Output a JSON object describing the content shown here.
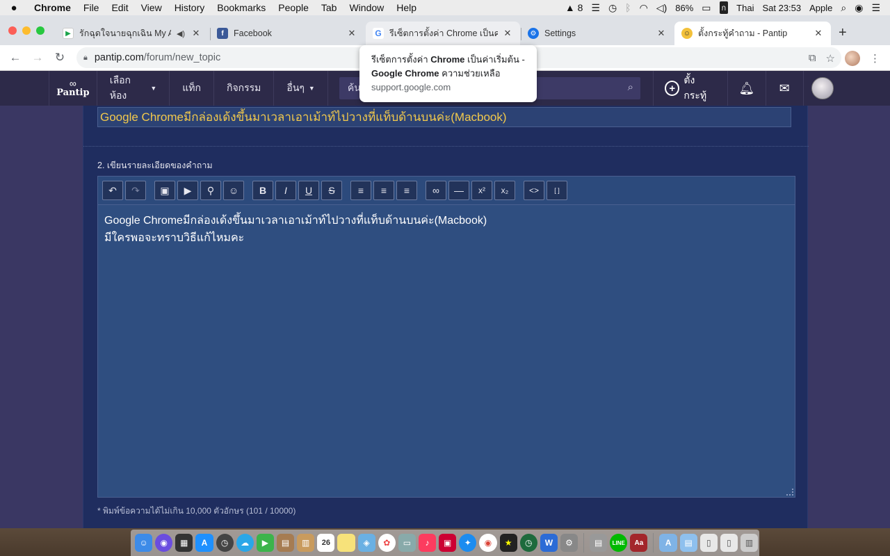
{
  "menubar": {
    "apple": "",
    "items": [
      "Chrome",
      "File",
      "Edit",
      "View",
      "History",
      "Bookmarks",
      "People",
      "Tab",
      "Window",
      "Help"
    ],
    "adobe_count": "8",
    "battery": "86%",
    "input_source": "Thai",
    "clock": "Sat 23:53",
    "user": "Apple"
  },
  "tabs": [
    {
      "title": "รักฉุดใจนายฉุกเฉิน My Am",
      "favicon": "play-icon",
      "active": false
    },
    {
      "title": "Facebook",
      "favicon": "facebook-icon",
      "active": false
    },
    {
      "title": "รีเซ็ตการตั้งค่า Chrome เป็นค่าเ",
      "favicon": "google-icon",
      "active": false
    },
    {
      "title": "Settings",
      "favicon": "gear-icon",
      "active": false
    },
    {
      "title": "ตั้งกระทู้คำถาม - Pantip",
      "favicon": "pantip-emoji-icon",
      "active": true
    }
  ],
  "toolbar": {
    "url_host": "pantip.com",
    "url_path": "/forum/new_topic"
  },
  "tooltip": {
    "title_part1": "รีเซ็ตการตั้งค่า ",
    "title_bold1": "Chrome",
    "title_part2": " เป็นค่าเริ่มต้น -",
    "title_bold2": "Google Chrome",
    "title_part3": " ความช่วยเหลือ",
    "url": "support.google.com"
  },
  "pantip_header": {
    "logo_text": "Pantip",
    "nav": [
      "เลือกห้อง",
      "แท็ก",
      "กิจกรรม",
      "อื่นๆ"
    ],
    "search_placeholder": "ค้นหา",
    "post_label": "ตั้งกระทู้"
  },
  "form": {
    "title_value": "Google Chromeมีกล่องเด้งขึ้นมาเวลาเอาเม้าท์ไปวางที่แท็บด้านบนค่ะ(Macbook)",
    "section_label": "2. เขียนรายละเอียดของคำถาม",
    "body_lines": [
      "Google Chromeมีกล่องเด้งขึ้นมาเวลาเอาเม้าท์ไปวางที่แท็บด้านบนค่ะ(Macbook)",
      "มีใครพอจะทราบวิธีแก้ไหมคะ"
    ],
    "counter": "* พิมพ์ข้อความได้ไม่เกิน 10,000 ตัวอักษร (101 / 10000)"
  },
  "editor_tools": [
    {
      "name": "undo-icon",
      "glyph": "↶"
    },
    {
      "name": "redo-icon",
      "glyph": "↷"
    },
    {
      "name": "image-icon",
      "glyph": "▣"
    },
    {
      "name": "video-icon",
      "glyph": "▶"
    },
    {
      "name": "map-pin-icon",
      "glyph": "⬤"
    },
    {
      "name": "emoji-icon",
      "glyph": "☺"
    },
    {
      "name": "bold-icon",
      "glyph": "B"
    },
    {
      "name": "italic-icon",
      "glyph": "I"
    },
    {
      "name": "underline-icon",
      "glyph": "U"
    },
    {
      "name": "strikethrough-icon",
      "glyph": "S"
    },
    {
      "name": "align-left-icon",
      "glyph": "≡"
    },
    {
      "name": "align-center-icon",
      "glyph": "≡"
    },
    {
      "name": "align-right-icon",
      "glyph": "≡"
    },
    {
      "name": "link-icon",
      "glyph": "⊂⊃"
    },
    {
      "name": "horizontal-rule-icon",
      "glyph": "—"
    },
    {
      "name": "superscript-icon",
      "glyph": "x²"
    },
    {
      "name": "subscript-icon",
      "glyph": "x₂"
    },
    {
      "name": "code-icon",
      "glyph": "<>"
    },
    {
      "name": "spoil-icon",
      "glyph": "[ ]"
    }
  ],
  "colors": {
    "pantip_header": "#2d2a49",
    "content_bg": "#1f2d5f",
    "title_text": "#f2c94c",
    "editor_bg": "#2f4e80"
  },
  "dock": {
    "calendar_day": "26"
  }
}
